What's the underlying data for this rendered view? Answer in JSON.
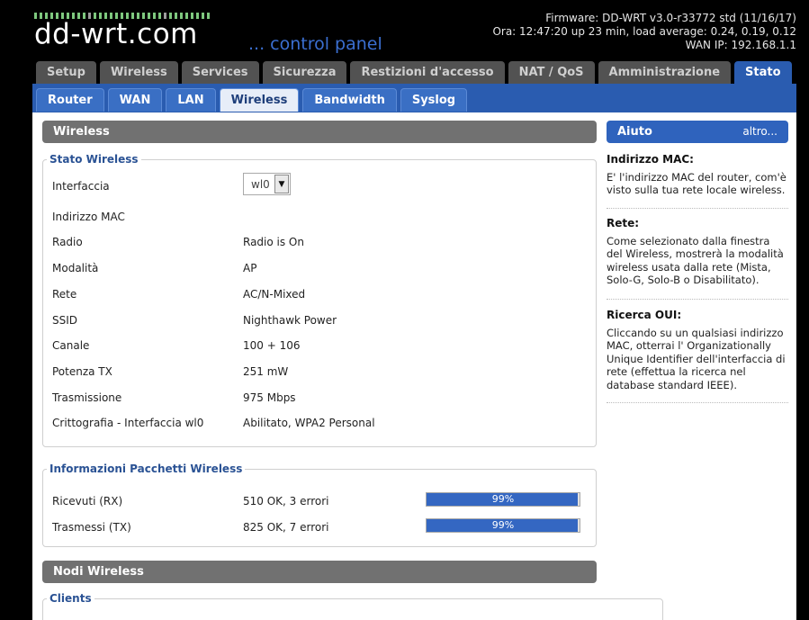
{
  "header": {
    "logo": "dd-wrt.com",
    "subtitle": "... control panel",
    "firmware": "Firmware: DD-WRT v3.0-r33772 std (11/16/17)",
    "time": "Ora: 12:47:20 up 23 min, load average: 0.24, 0.19, 0.12",
    "wan_ip": "WAN IP: 192.168.1.1"
  },
  "main_tabs": [
    "Setup",
    "Wireless",
    "Services",
    "Sicurezza",
    "Restizioni d'accesso",
    "NAT / QoS",
    "Amministrazione",
    "Stato"
  ],
  "sub_tabs": [
    "Router",
    "WAN",
    "LAN",
    "Wireless",
    "Bandwidth",
    "Syslog"
  ],
  "section_wireless": "Wireless",
  "stato": {
    "legend": "Stato Wireless",
    "rows": [
      {
        "label": "Interfaccia",
        "value": ""
      },
      {
        "label": "Indirizzo MAC",
        "value": ""
      },
      {
        "label": "Radio",
        "value": "Radio is On"
      },
      {
        "label": "Modalità",
        "value": "AP"
      },
      {
        "label": "Rete",
        "value": "AC/N-Mixed"
      },
      {
        "label": "SSID",
        "value": "Nighthawk Power"
      },
      {
        "label": "Canale",
        "value": "100 + 106"
      },
      {
        "label": "Potenza TX",
        "value": "251 mW"
      },
      {
        "label": "Trasmissione",
        "value": "975 Mbps"
      },
      {
        "label": "Crittografia - Interfaccia wl0",
        "value": "Abilitato, WPA2 Personal"
      }
    ],
    "interface_select": "wl0"
  },
  "pacchetti": {
    "legend": "Informazioni Pacchetti Wireless",
    "rows": [
      {
        "label": "Ricevuti (RX)",
        "value": "510 OK, 3 errori",
        "percent": "99%",
        "fill": 0.99
      },
      {
        "label": "Trasmessi (TX)",
        "value": "825 OK, 7 errori",
        "percent": "99%",
        "fill": 0.99
      }
    ]
  },
  "section_nodi": "Nodi Wireless",
  "clients_legend": "Clients",
  "help": {
    "title": "Aiuto",
    "more": "altro...",
    "blocks": [
      {
        "title": "Indirizzo MAC:",
        "text": "E' l'indirizzo MAC del router, com'è visto sulla tua rete locale wireless."
      },
      {
        "title": "Rete:",
        "text": "Come selezionato dalla finestra del Wireless, mostrerà la modalità wireless usata dalla rete (Mista, Solo-G, Solo-B o Disabilitato)."
      },
      {
        "title": "Ricerca OUI:",
        "text": "Cliccando su un qualsiasi indirizzo MAC, otterrai l' Organizationally Unique Identifier dell'interfaccia di rete (effettua la ricerca nel database standard IEEE)."
      }
    ]
  },
  "colors": {
    "accent": "#2a5cb0",
    "section_bar": "#717171",
    "legend_text": "#2a5294",
    "progress_fill": "#3467c2"
  }
}
